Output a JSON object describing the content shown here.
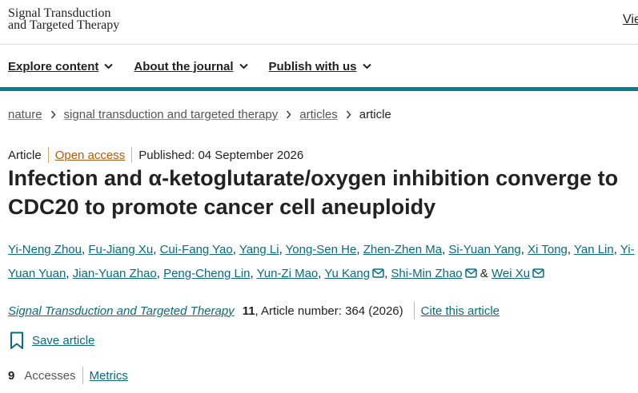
{
  "header": {
    "logo_line1": "Signal Transduction",
    "logo_line2": "and Targeted Therapy",
    "right_link": "View"
  },
  "nav": [
    {
      "label": "Explore content",
      "icon": "chevron-down-icon"
    },
    {
      "label": "About the journal",
      "icon": "chevron-down-icon"
    },
    {
      "label": "Publish with us",
      "icon": "chevron-down-icon"
    }
  ],
  "breadcrumb": {
    "items": [
      "nature",
      "signal transduction and targeted therapy",
      "articles"
    ],
    "current": "article"
  },
  "meta": {
    "type": "Article",
    "access": "Open access",
    "published": "Published: 04 September 2026"
  },
  "title": "Infection and α-ketoglutarate/oxygen inhibition converge to CDC20 to promote cancer cell aneuploidy",
  "authors": [
    {
      "name": "Yi-Neng Zhou",
      "mail": false
    },
    {
      "name": "Fu-Jiang Xu",
      "mail": false
    },
    {
      "name": "Cui-Fang Yao",
      "mail": false
    },
    {
      "name": "Yang Li",
      "mail": false
    },
    {
      "name": "Yong-Sen He",
      "mail": false
    },
    {
      "name": "Zhen-Zhen Ma",
      "mail": false
    },
    {
      "name": "Si-Yuan Yang",
      "mail": false
    },
    {
      "name": "Xi Tong",
      "mail": false
    },
    {
      "name": "Yan Lin",
      "mail": false
    },
    {
      "name": "Yi-Yuan Yuan",
      "mail": false
    },
    {
      "name": "Jian-Yuan Zhao",
      "mail": false
    },
    {
      "name": "Peng-Cheng Lin",
      "mail": false
    },
    {
      "name": "Yun-Zi Mao",
      "mail": false
    },
    {
      "name": "Yu Kang",
      "mail": true
    },
    {
      "name": "Shi-Min Zhao",
      "mail": true
    },
    {
      "name": "Wei Xu",
      "mail": true
    }
  ],
  "authors_and": "&",
  "journal": {
    "name": "Signal Transduction and Targeted Therapy",
    "volume": "11",
    "article_number": ", Article number: 364 (2026)",
    "cite_label": "Cite this article"
  },
  "save": {
    "label": "Save article",
    "icon": "bookmark-icon"
  },
  "metrics": {
    "accesses_count": "9",
    "accesses_label": "Accesses",
    "metrics_link": "Metrics"
  },
  "colors": {
    "accent_teal": "#0a7b8b",
    "link_teal": "#0a6b7d",
    "open_access_orange": "#b35a12"
  }
}
